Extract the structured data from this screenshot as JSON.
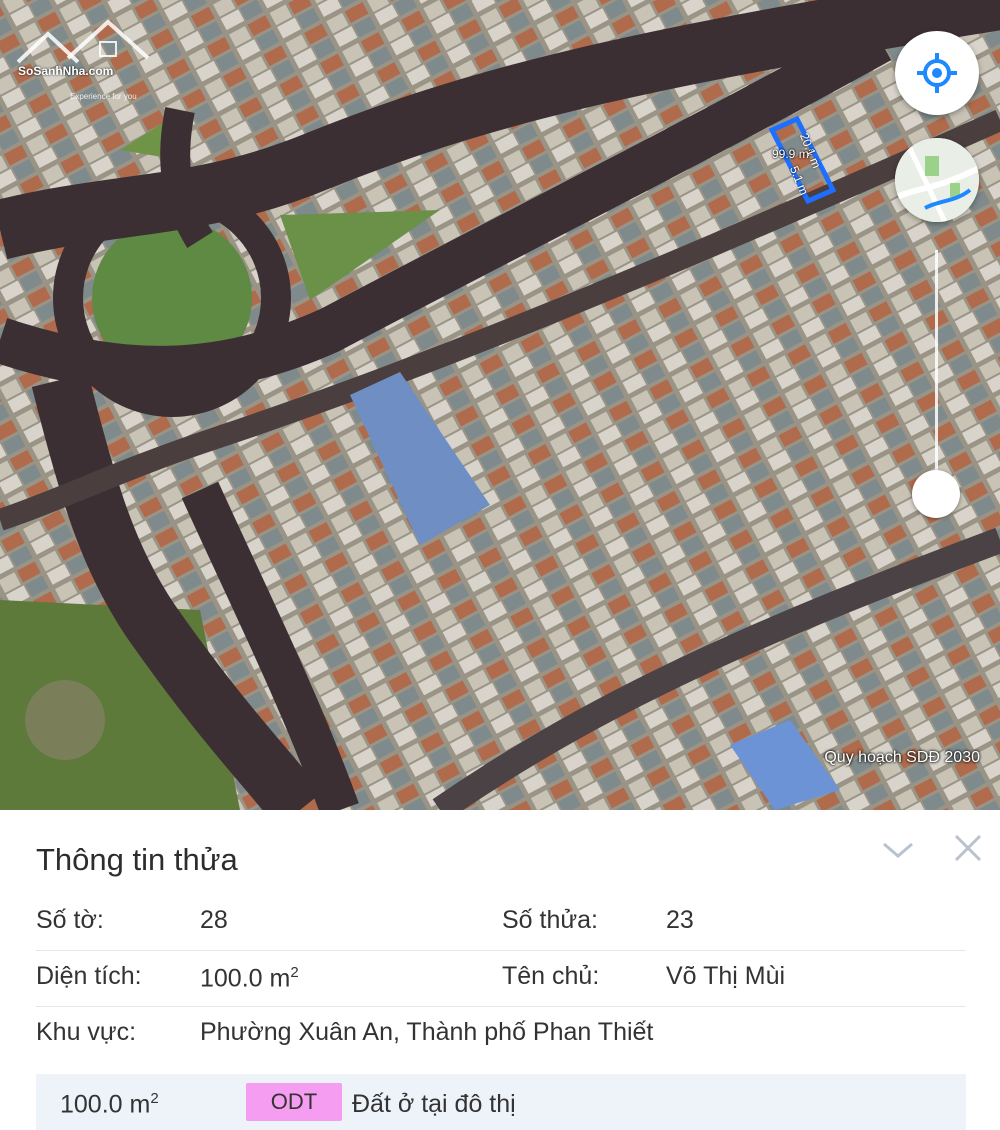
{
  "map": {
    "logo_text": "SoSanhNha.com",
    "logo_tagline": "Experience for you",
    "overlay_label": "Quy hoạch SDĐ 2030",
    "parcel": {
      "area_label": "99.9 m²",
      "length_label": "20.1 m",
      "width_label": "5.1 m",
      "outline_color": "#1e6fff"
    },
    "controls": {
      "locate_icon": "crosshair-locate-icon",
      "layers_icon": "map-layer-thumbnail-icon"
    },
    "accent_color": "#1e88ff"
  },
  "panel": {
    "title": "Thông tin thửa",
    "collapse_icon": "chevron-down-icon",
    "close_icon": "close-icon",
    "so_to_label": "Số tờ:",
    "so_to_value": "28",
    "so_thua_label": "Số thửa:",
    "so_thua_value": "23",
    "dien_tich_label": "Diện tích:",
    "dien_tich_value": "100.0 m",
    "dien_tich_unit_sup": "2",
    "ten_chu_label": "Tên chủ:",
    "ten_chu_value": "Võ Thị Mùi",
    "khu_vuc_label": "Khu vực:",
    "khu_vuc_value": "Phường Xuân An, Thành phố Phan Thiết",
    "land_use": {
      "area": "100.0 m",
      "area_sup": "2",
      "code": "ODT",
      "code_color": "#f49df1",
      "description": "Đất ở tại đô thị"
    }
  }
}
